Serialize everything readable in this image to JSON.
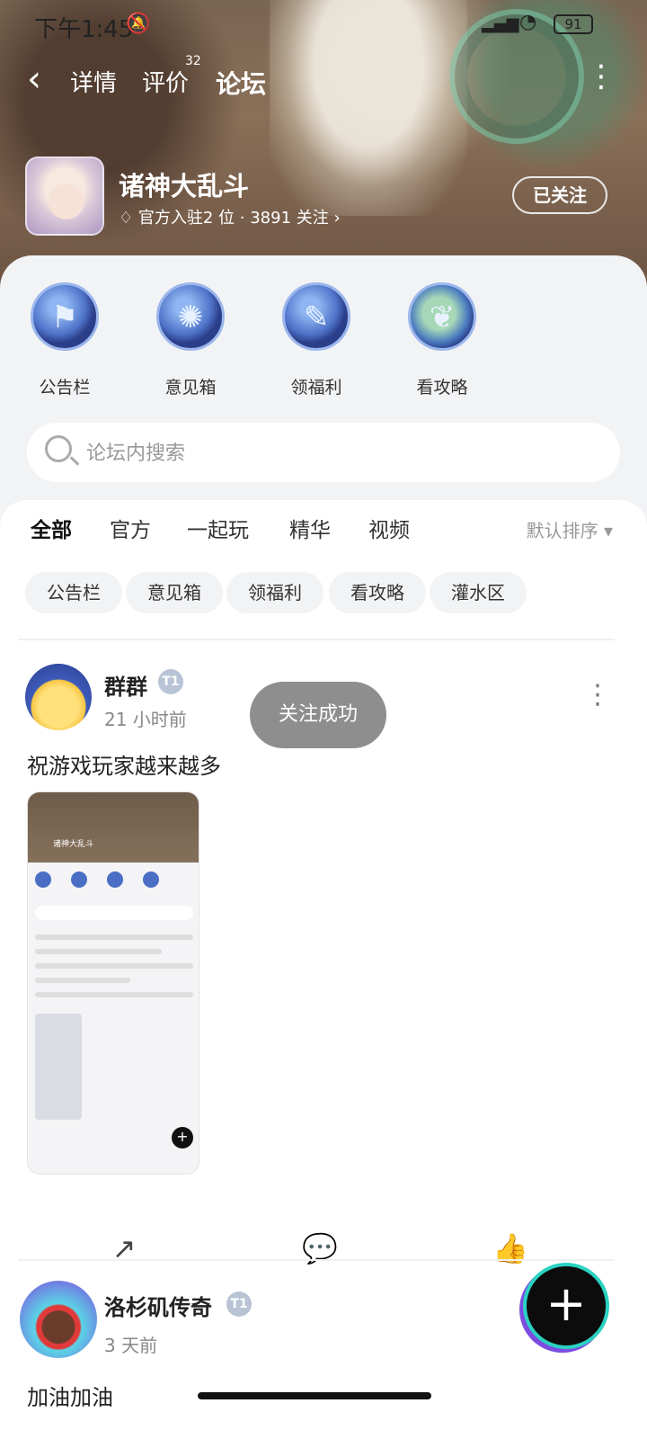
{
  "status": {
    "time": "下午1:45",
    "battery": "91"
  },
  "nav": {
    "tabs": [
      {
        "label": "详情"
      },
      {
        "label": "评价",
        "badge": "32"
      },
      {
        "label": "论坛"
      }
    ],
    "active_tab": "论坛"
  },
  "game": {
    "name": "诸神大乱斗",
    "meta": "官方入驻2 位 · 3891 关注 ›",
    "follow_label": "已关注"
  },
  "quick_links": [
    {
      "label": "公告栏",
      "icon": "scroll-flag-icon"
    },
    {
      "label": "意见箱",
      "icon": "galaxy-icon"
    },
    {
      "label": "领福利",
      "icon": "scroll-icon"
    },
    {
      "label": "看攻略",
      "icon": "tree-icon"
    }
  ],
  "search": {
    "placeholder": "论坛内搜索"
  },
  "filter_tabs": [
    {
      "label": "全部",
      "active": true
    },
    {
      "label": "官方"
    },
    {
      "label": "一起玩"
    },
    {
      "label": "精华"
    },
    {
      "label": "视频"
    }
  ],
  "sort_label": "默认排序 ▾",
  "chips": [
    "公告栏",
    "意见箱",
    "领福利",
    "看攻略",
    "灌水区"
  ],
  "posts": [
    {
      "author": "群群",
      "level": "T1",
      "time": "21 小时前",
      "content": "祝游戏玩家越来越多"
    },
    {
      "author": "洛杉矶传奇",
      "level": "T1",
      "time": "3 天前",
      "content": "加油加油"
    }
  ],
  "toast": "关注成功",
  "icons": {
    "share": "share-icon",
    "comment": "comment-icon",
    "like": "thumbs-up-icon"
  },
  "colors": {
    "accent": "#19c8b9",
    "fab_ring": "#2bd2c2"
  }
}
